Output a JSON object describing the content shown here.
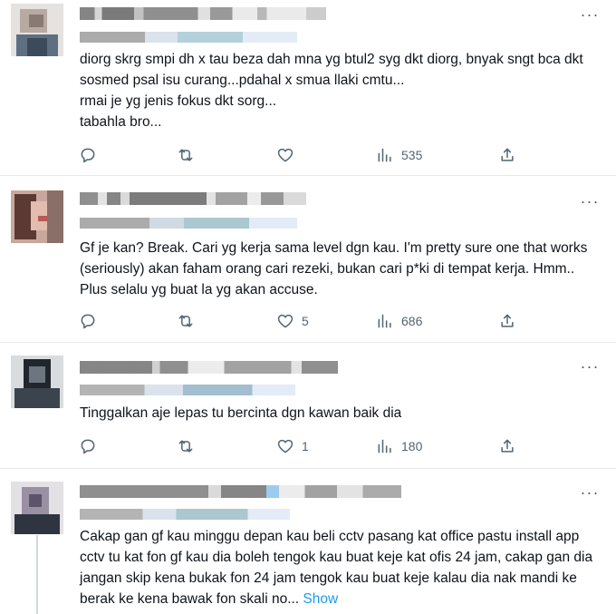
{
  "tweets": [
    {
      "text": "diorg skrg smpi dh x tau beza dah mna yg btul2 syg dkt diorg, bnyak sngt bca dkt sosmed psal isu curang...pdahal x smua llaki cmtu...\nrmai je yg jenis fokus dkt sorg...\ntabahla bro...",
      "likes": "",
      "views": "535",
      "more": "···"
    },
    {
      "text": "Gf je kan? Break. Cari yg kerja sama level dgn kau. I'm pretty sure one that works (seriously) akan faham orang cari rezeki, bukan cari p*ki di tempat kerja. Hmm.. Plus selalu yg buat la yg akan accuse.",
      "likes": "5",
      "views": "686",
      "more": "···"
    },
    {
      "text": "Tinggalkan aje lepas tu bercinta dgn kawan baik dia",
      "likes": "1",
      "views": "180",
      "more": "···"
    },
    {
      "text": "Cakap gan gf kau minggu depan kau beli cctv pasang kat office pastu install app cctv tu kat fon gf kau dia boleh tengok kau buat keje kat ofis 24 jam, cakap gan dia jangan skip kena bukak fon 24 jam tengok kau buat keje kalau dia nak mandi ke berak ke kena bawak fon skali no...",
      "show_more": " Show",
      "likes": "",
      "views": "",
      "more": "···"
    }
  ],
  "icons": {
    "reply": "reply-icon",
    "retweet": "retweet-icon",
    "like": "heart-icon",
    "views": "views-icon",
    "share": "share-icon",
    "more": "more-icon"
  },
  "colors": {
    "accent": "#1d9bf0",
    "muted": "#536471",
    "divider": "#e6e8ea"
  }
}
